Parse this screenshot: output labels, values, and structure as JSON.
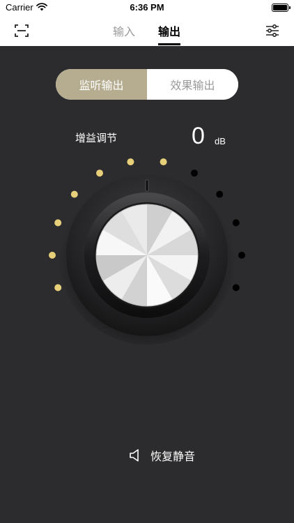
{
  "status_bar": {
    "carrier": "Carrier",
    "time": "6:36 PM"
  },
  "nav": {
    "tabs": [
      {
        "label": "输入",
        "active": false
      },
      {
        "label": "输出",
        "active": true
      }
    ]
  },
  "segmented": {
    "active": "监听输出",
    "inactive": "效果输出"
  },
  "gain": {
    "label": "增益调节",
    "value": "0",
    "unit": "dB",
    "level_dots_active": 7,
    "level_dots_total": 12
  },
  "restore": {
    "label": "恢复静音"
  },
  "colors": {
    "accent": "#b6ad91",
    "dot_active": "#e8d07a",
    "dot_inactive": "#000000",
    "background": "#2c2c2e"
  },
  "icons": {
    "scan": "scan-frame-icon",
    "settings": "sliders-icon",
    "speaker": "speaker-icon"
  }
}
